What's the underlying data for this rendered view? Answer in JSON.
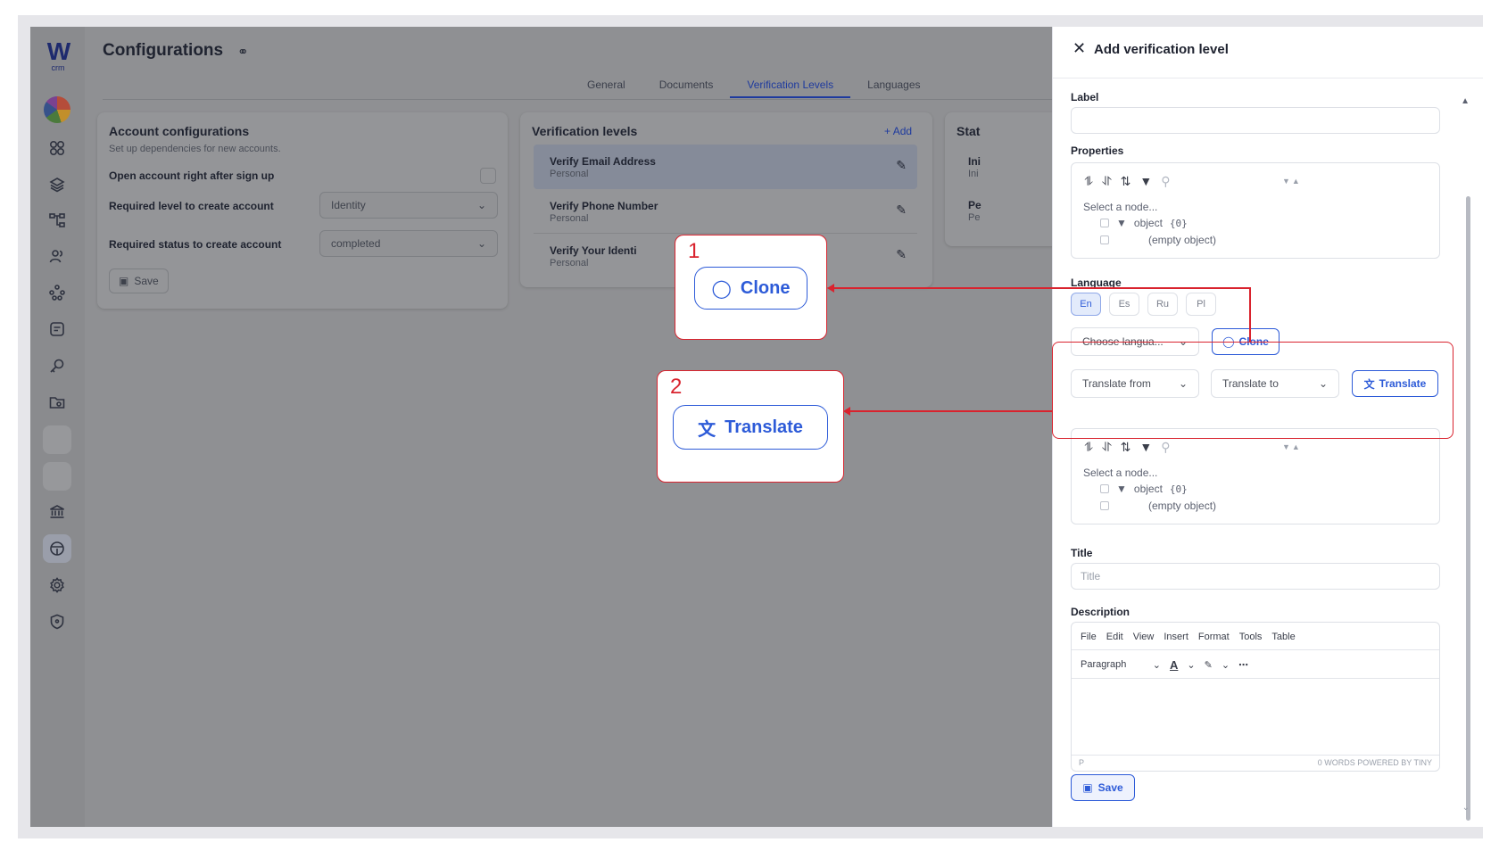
{
  "app": {
    "logo_letter": "W",
    "logo_sub": "crm",
    "page_title": "Configurations",
    "tabs": [
      "General",
      "Documents",
      "Verification Levels",
      "Languages"
    ],
    "active_tab": "Verification Levels"
  },
  "account_config": {
    "title": "Account configurations",
    "subtitle": "Set up dependencies for new accounts.",
    "open_account_label": "Open account right  after sign up",
    "required_level_label": "Required level to create account",
    "required_level_value": "Identity",
    "required_status_label": "Required status to create account",
    "required_status_value": "completed",
    "save_label": "Save"
  },
  "verification_levels": {
    "title": "Verification levels",
    "add_label": "Add",
    "items": [
      {
        "name": "Verify Email Address",
        "sub": "Personal"
      },
      {
        "name": "Verify Phone Number",
        "sub": "Personal"
      },
      {
        "name": "Verify Your Identi",
        "sub": "Personal"
      }
    ]
  },
  "status_card": {
    "title": "Stat",
    "rows": [
      {
        "name": "Ini",
        "sub": "Ini"
      },
      {
        "name": "Pe",
        "sub": "Pe"
      }
    ]
  },
  "drawer": {
    "title": "Add verification level",
    "label_label": "Label",
    "properties_label": "Properties",
    "tree": {
      "hint": "Select a node...",
      "root": "object",
      "root_count": "{0}",
      "empty": "(empty object)"
    },
    "language_label": "Language",
    "languages": [
      "En",
      "Es",
      "Ru",
      "Pl"
    ],
    "active_language": "En",
    "choose_language_placeholder": "Choose langua...",
    "clone_label": "Clone",
    "translate_from": "Translate from",
    "translate_to": "Translate to",
    "translate_label": "Translate",
    "title_label": "Title",
    "title_placeholder": "Title",
    "description_label": "Description",
    "editor_menu": [
      "File",
      "Edit",
      "View",
      "Insert",
      "Format",
      "Tools",
      "Table"
    ],
    "editor_block": "Paragraph",
    "editor_path": "P",
    "editor_status": "0 WORDS  POWERED BY TINY",
    "save_label": "Save"
  },
  "annotations": {
    "callout1_num": "1",
    "callout1_label": "Clone",
    "callout2_num": "2",
    "callout2_label": "Translate",
    "color": "#d9232e"
  },
  "colors": {
    "accent": "#2d5bd8",
    "overlay": "#8f9093"
  }
}
